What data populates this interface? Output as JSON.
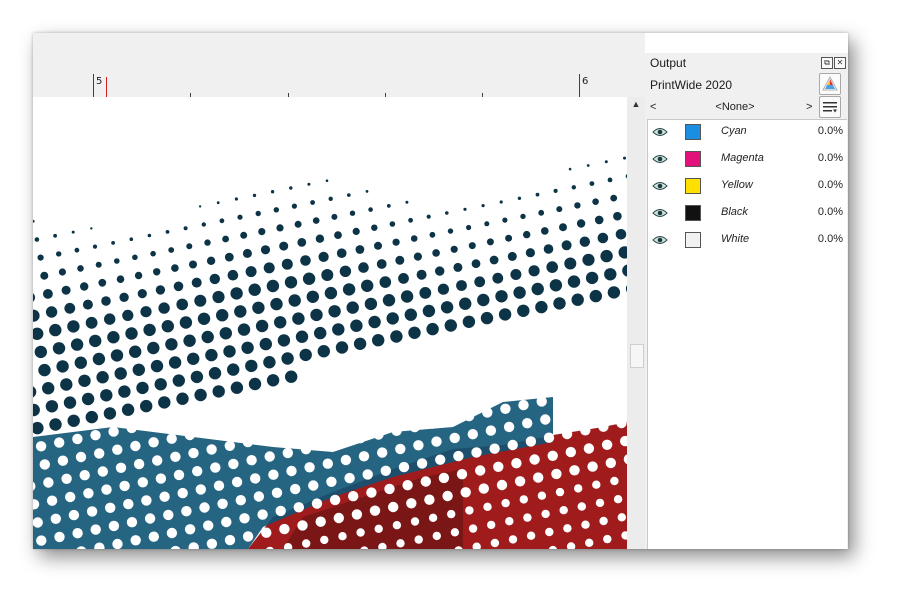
{
  "ruler": {
    "label_5": "5",
    "label_6": "6"
  },
  "panel": {
    "title": "Output",
    "printer": "PrintWide 2020",
    "nav_prev": "<",
    "nav_current": "<None>",
    "nav_next": ">",
    "channels": [
      {
        "name": "Cyan",
        "value": "0.0%",
        "color": "#1a8ee0"
      },
      {
        "name": "Magenta",
        "value": "0.0%",
        "color": "#e2127a"
      },
      {
        "name": "Yellow",
        "value": "0.0%",
        "color": "#ffe000"
      },
      {
        "name": "Black",
        "value": "0.0%",
        "color": "#111111"
      },
      {
        "name": "White",
        "value": "0.0%",
        "color": "#f2f2f2"
      }
    ]
  },
  "artwork": {
    "dot_color": "#0d3346",
    "cyan_tone": "#0e5474",
    "red_tone": "#a01c1c",
    "dark_red_tone": "#6a1414"
  }
}
